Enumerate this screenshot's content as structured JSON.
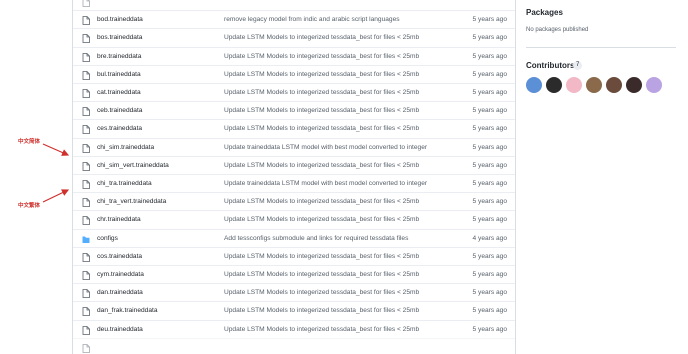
{
  "files": [
    {
      "name": "",
      "message": "",
      "age": "5 years ago",
      "partial": true
    },
    {
      "name": "bod.traineddata",
      "message": "remove legacy model from indic and arabic script languages",
      "age": "5 years ago"
    },
    {
      "name": "bos.traineddata",
      "message": "Update LSTM Models to integerized tessdata_best for files < 25mb",
      "age": "5 years ago"
    },
    {
      "name": "bre.traineddata",
      "message": "Update LSTM Models to integerized tessdata_best for files < 25mb",
      "age": "5 years ago"
    },
    {
      "name": "bul.traineddata",
      "message": "Update LSTM Models to integerized tessdata_best for files < 25mb",
      "age": "5 years ago"
    },
    {
      "name": "cat.traineddata",
      "message": "Update LSTM Models to integerized tessdata_best for files < 25mb",
      "age": "5 years ago"
    },
    {
      "name": "ceb.traineddata",
      "message": "Update LSTM Models to integerized tessdata_best for files < 25mb",
      "age": "5 years ago"
    },
    {
      "name": "ces.traineddata",
      "message": "Update LSTM Models to integerized tessdata_best for files < 25mb",
      "age": "5 years ago"
    },
    {
      "name": "chi_sim.traineddata",
      "message": "Update traineddata LSTM model with best model converted to integer",
      "age": "5 years ago"
    },
    {
      "name": "chi_sim_vert.traineddata",
      "message": "Update LSTM Models to integerized tessdata_best for files < 25mb",
      "age": "5 years ago"
    },
    {
      "name": "chi_tra.traineddata",
      "message": "Update traineddata LSTM model with best model converted to integer",
      "age": "5 years ago"
    },
    {
      "name": "chi_tra_vert.traineddata",
      "message": "Update LSTM Models to integerized tessdata_best for files < 25mb",
      "age": "5 years ago"
    },
    {
      "name": "chr.traineddata",
      "message": "Update LSTM Models to integerized tessdata_best for files < 25mb",
      "age": "5 years ago"
    },
    {
      "name": "configs",
      "message": "Add tessconfigs submodule and links for required tessdata files",
      "age": "4 years ago",
      "folder": true
    },
    {
      "name": "cos.traineddata",
      "message": "Update LSTM Models to integerized tessdata_best for files < 25mb",
      "age": "5 years ago"
    },
    {
      "name": "cym.traineddata",
      "message": "Update LSTM Models to integerized tessdata_best for files < 25mb",
      "age": "5 years ago"
    },
    {
      "name": "dan.traineddata",
      "message": "Update LSTM Models to integerized tessdata_best for files < 25mb",
      "age": "5 years ago"
    },
    {
      "name": "dan_frak.traineddata",
      "message": "Update LSTM Models to integerized tessdata_best for files < 25mb",
      "age": "5 years ago"
    },
    {
      "name": "deu.traineddata",
      "message": "Update LSTM Models to integerized tessdata_best for files < 25mb",
      "age": "5 years ago"
    },
    {
      "name": "",
      "message": "",
      "age": "",
      "partial": true
    }
  ],
  "sidebar": {
    "packages_title": "Packages",
    "packages_note": "No packages published",
    "contributors_title": "Contributors",
    "contributors_count": "7",
    "avatar_colors": [
      "#5b8fd6",
      "#2b2b2b",
      "#f2b8c6",
      "#8a6a4a",
      "#6b4b3b",
      "#3a2a2a",
      "#b9a3e3"
    ]
  },
  "annotations": [
    {
      "label": "中文简体",
      "color": "#d0302c"
    },
    {
      "label": "中文繁体",
      "color": "#d0302c"
    }
  ]
}
